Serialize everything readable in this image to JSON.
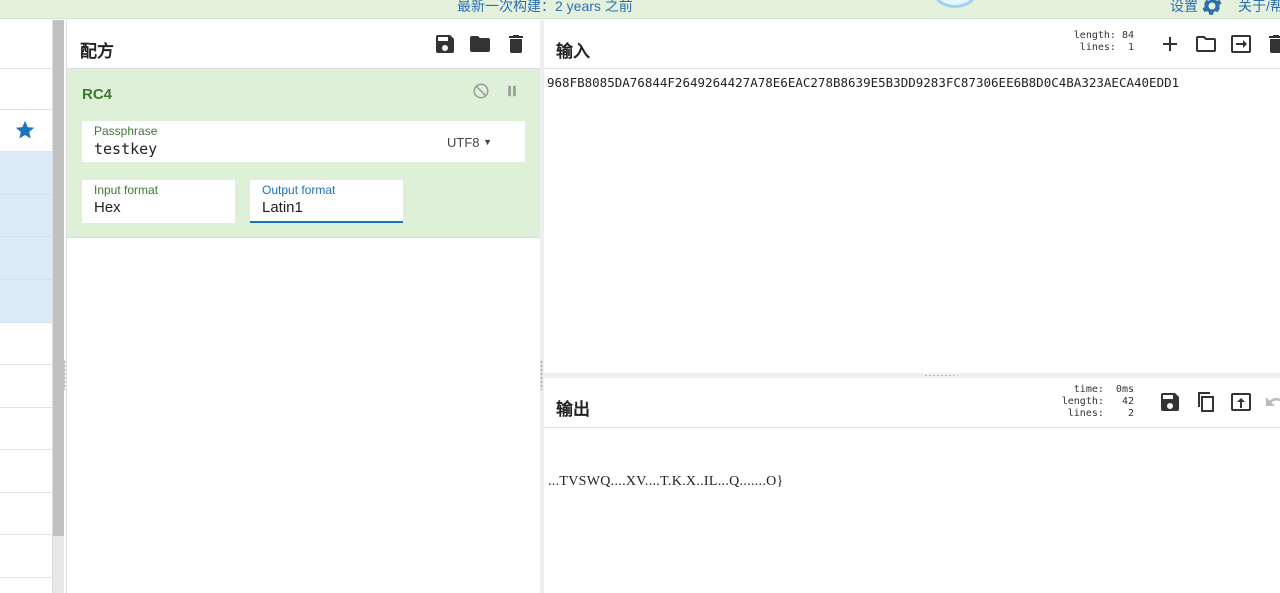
{
  "banner": {
    "build_text": "最新一次构建：2 years 之前",
    "settings_label": "设置",
    "about_label": "关于/帮"
  },
  "recipe": {
    "title": "配方",
    "operation": {
      "name": "RC4",
      "passphrase": {
        "label": "Passphrase",
        "value": "testkey",
        "encoding": "UTF8"
      },
      "input_format": {
        "label": "Input format",
        "value": "Hex"
      },
      "output_format": {
        "label": "Output format",
        "value": "Latin1"
      }
    }
  },
  "input": {
    "title": "输入",
    "stats": "length: 84\n lines:  1",
    "text": "968FB8085DA76844F2649264427A78E6EAC278B8639E5B3DD9283FC87306EE6B8D0C4BA323AECA40EDD1"
  },
  "output": {
    "title": "输出",
    "stats": "  time:  0ms\nlength:   42\n lines:    2",
    "text": "...TVSWQ....XV....T.K.X..IL...Q.......O}"
  },
  "icons": {
    "save": "save-icon",
    "open": "folder-icon",
    "clear": "trash-icon",
    "add": "plus-icon",
    "swap": "swap-icon",
    "copy": "copy-icon",
    "replace": "replace-input-icon",
    "undo": "undo-icon",
    "favourite": "star-icon",
    "disable": "disable-icon",
    "pause": "pause-icon",
    "gear": "gear-icon"
  },
  "colors": {
    "accent_green": "#3c7a32",
    "op_background": "#dff0d8",
    "focus_blue": "#1e73be",
    "link_blue": "#2f6fad",
    "selected_row": "#dcebf7"
  }
}
